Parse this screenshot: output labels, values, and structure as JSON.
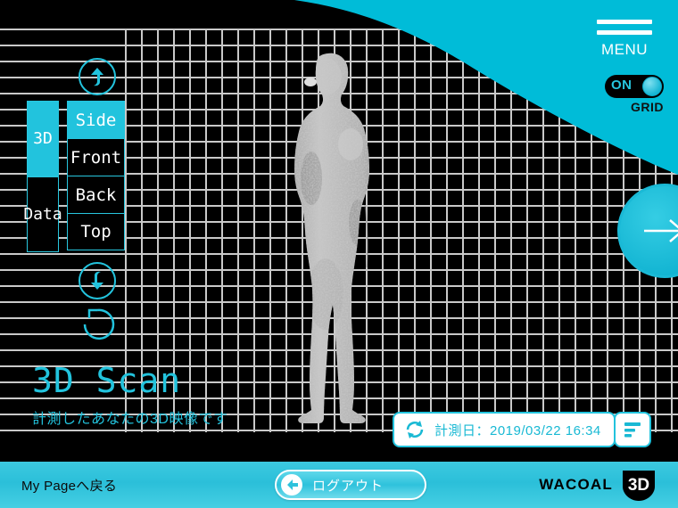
{
  "app": {
    "title": "3D Scan",
    "subtitle": "計測したあなたの3D映像です"
  },
  "header": {
    "menu_label": "MENU",
    "menu_icon": "hamburger-icon",
    "grid_toggle": {
      "state_label": "ON",
      "caption": "GRID"
    },
    "accent_color": "#00bcd8"
  },
  "nav": {
    "modes": [
      {
        "label": "3D",
        "active": true
      },
      {
        "label": "Data",
        "active": false
      }
    ],
    "views": [
      {
        "label": "Side",
        "active": true
      },
      {
        "label": "Front",
        "active": false
      },
      {
        "label": "Back",
        "active": false
      },
      {
        "label": "Top",
        "active": false
      }
    ],
    "rotate_up_icon": "arrow-up-circle-icon",
    "rotate_down_icon": "arrow-down-circle-icon",
    "reset_icon": "rotate-ccw-icon",
    "next_icon": "arrow-right-icon"
  },
  "scan": {
    "figure_alt": "3d-body-scan-point-cloud",
    "date_icon": "refresh-icon",
    "date_label": "計測日：2019/03/22 16:34",
    "list_icon": "list-lines-icon"
  },
  "footer": {
    "mypage_label": "My Pageへ戻る",
    "logout_label": "ログアウト",
    "logout_icon": "arrow-left-circle-icon",
    "brand_word": "WACOAL",
    "brand_mark": "3D"
  }
}
